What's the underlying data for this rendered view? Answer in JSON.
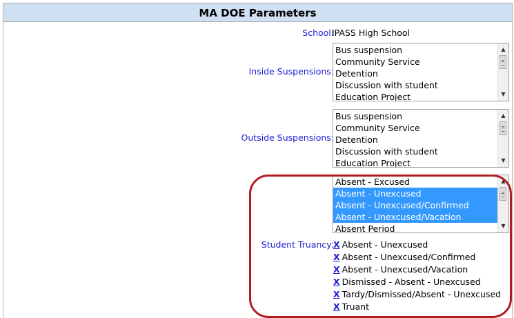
{
  "panel": {
    "title": "MA DOE Parameters"
  },
  "school": {
    "label": "School:",
    "value": "IPASS High School"
  },
  "inside_suspensions": {
    "label": "Inside Suspensions:",
    "options": [
      "Bus suspension",
      "Community Service",
      "Detention",
      "Discussion with student",
      "Education Project"
    ]
  },
  "outside_suspensions": {
    "label": "Outside Suspensions:",
    "options": [
      "Bus suspension",
      "Community Service",
      "Detention",
      "Discussion with student",
      "Education Project"
    ]
  },
  "student_truancy": {
    "label": "Student Truancy:",
    "options": [
      {
        "text": "Absent - Excused",
        "selected": false
      },
      {
        "text": "Absent - Unexcused",
        "selected": true
      },
      {
        "text": "Absent - Unexcused/Confirmed",
        "selected": true
      },
      {
        "text": "Absent - Unexcused/Vacation",
        "selected": true
      },
      {
        "text": "Absent Period",
        "selected": false
      }
    ],
    "remove_glyph": "X",
    "selected_items": [
      "Absent - Unexcused",
      "Absent - Unexcused/Confirmed",
      "Absent - Unexcused/Vacation",
      "Dismissed - Absent - Unexcused",
      "Tardy/Dismissed/Absent - Unexcused",
      "Truant"
    ]
  },
  "colors": {
    "header_bg": "#cfe0f3",
    "label_text": "#1d1dd3",
    "selection_bg": "#3399ff",
    "highlight_border": "#b01c22"
  },
  "icons": {
    "scroll_up": "scroll-up-arrow-icon",
    "scroll_down": "scroll-down-arrow-icon"
  }
}
